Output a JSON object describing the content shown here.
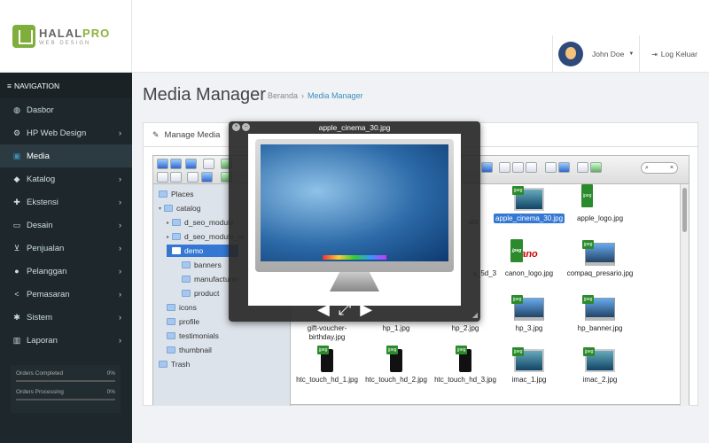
{
  "brand": {
    "name_a": "HALAL",
    "name_b": "PRO",
    "sub": "WEB DESIGN"
  },
  "user": {
    "name": "John Doe"
  },
  "logout": "Log Keluar",
  "sidebar": {
    "header": "NAVIGATION",
    "items": [
      {
        "label": "Dasbor",
        "icon": "dashboard-icon",
        "glyph": "◍",
        "chev": ""
      },
      {
        "label": "HP Web Design",
        "icon": "cogs-icon",
        "glyph": "⚙",
        "chev": "›"
      },
      {
        "label": "Media",
        "icon": "image-icon",
        "glyph": "▣",
        "chev": ""
      },
      {
        "label": "Katalog",
        "icon": "tag-icon",
        "glyph": "◆",
        "chev": "›"
      },
      {
        "label": "Ekstensi",
        "icon": "puzzle-icon",
        "glyph": "✚",
        "chev": "›"
      },
      {
        "label": "Desain",
        "icon": "monitor-icon",
        "glyph": "▭",
        "chev": "›"
      },
      {
        "label": "Penjualan",
        "icon": "cart-icon",
        "glyph": "⊻",
        "chev": "›"
      },
      {
        "label": "Pelanggan",
        "icon": "user-icon",
        "glyph": "●",
        "chev": "›"
      },
      {
        "label": "Pemasaran",
        "icon": "share-icon",
        "glyph": "<",
        "chev": "›"
      },
      {
        "label": "Sistem",
        "icon": "gear-icon",
        "glyph": "✱",
        "chev": "›"
      },
      {
        "label": "Laporan",
        "icon": "bar-chart-icon",
        "glyph": "▥",
        "chev": "›"
      }
    ],
    "stats": [
      {
        "label": "Orders Completed",
        "value": "0%"
      },
      {
        "label": "Orders Processing",
        "value": "0%"
      }
    ]
  },
  "page": {
    "title": "Media Manager",
    "breadcrumb_home": "Beranda",
    "breadcrumb_current": "Media Manager"
  },
  "panel": {
    "title": "Manage Media"
  },
  "tree": [
    {
      "label": "Places",
      "level": 0
    },
    {
      "label": "catalog",
      "level": 0
    },
    {
      "label": "d_seo_module",
      "level": 1
    },
    {
      "label": "d_seo_module_ur",
      "level": 1
    },
    {
      "label": "demo",
      "level": 1
    },
    {
      "label": "banners",
      "level": 2
    },
    {
      "label": "manufacturer",
      "level": 2
    },
    {
      "label": "product",
      "level": 2
    },
    {
      "label": "icons",
      "level": 1
    },
    {
      "label": "profile",
      "level": 1
    },
    {
      "label": "testimonials",
      "level": 1
    },
    {
      "label": "thumbnail",
      "level": 1
    },
    {
      "label": "Trash",
      "level": 0
    }
  ],
  "files": [
    {
      "name": "apple_cinema_30.jpg",
      "thumb": "mon",
      "jpeg": "jpeg"
    },
    {
      "name": "apple_logo.jpg",
      "thumb": "apple",
      "jpeg": "jpeg"
    },
    {
      "name": "canon_logo.jpg",
      "thumb": "red",
      "jpeg": "jpeg",
      "text": "ano"
    },
    {
      "name": "compaq_presario.jpg",
      "thumb": "laptop",
      "jpeg": "jpeg"
    },
    {
      "name": "gift-voucher-birthday.jpg",
      "thumb": "",
      "jpeg": ""
    },
    {
      "name": "hp_1.jpg",
      "thumb": "",
      "jpeg": ""
    },
    {
      "name": "hp_2.jpg",
      "thumb": "",
      "jpeg": ""
    },
    {
      "name": "hp_3.jpg",
      "thumb": "laptop",
      "jpeg": "jpeg"
    },
    {
      "name": "hp_banner.jpg",
      "thumb": "laptop",
      "jpeg": "jpeg"
    },
    {
      "name": "htc_touch_hd_1.jpg",
      "thumb": "phone",
      "jpeg": "jpeg"
    },
    {
      "name": "htc_touch_hd_2.jpg",
      "thumb": "phone",
      "jpeg": "jpeg"
    },
    {
      "name": "htc_touch_hd_3.jpg",
      "thumb": "phone",
      "jpeg": "jpeg"
    },
    {
      "name": "imac_1.jpg",
      "thumb": "mon",
      "jpeg": "jpeg"
    },
    {
      "name": "imac_2.jpg",
      "thumb": "mon",
      "jpeg": "jpeg"
    }
  ],
  "partial_files": [
    {
      "name": "uct"
    },
    {
      "name": "s_5d_3"
    }
  ],
  "viewer": {
    "title": "apple_cinema_30.jpg",
    "prev": "◀",
    "fullscreen": "⤢",
    "next": "▶"
  },
  "search_clear": "×",
  "colors": {
    "sidebar": "#1e282c",
    "active": "#2c3b41",
    "accent": "#3c8dbc",
    "selection": "#3478d4"
  }
}
